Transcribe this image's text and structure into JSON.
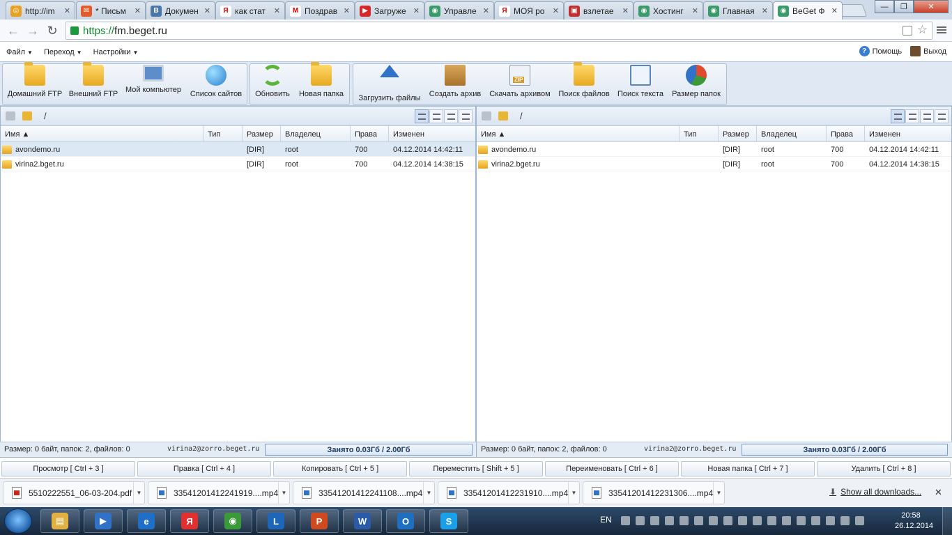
{
  "browser": {
    "tabs": [
      {
        "title": "http://im",
        "color": "#e8a020",
        "glyph": "◎"
      },
      {
        "title": "* Письм",
        "color": "#e45a2a",
        "glyph": "✉"
      },
      {
        "title": "Докумен",
        "color": "#4a76a8",
        "glyph": "B"
      },
      {
        "title": "как стат",
        "color": "#ffffff",
        "glyph": "Я"
      },
      {
        "title": "Поздрав",
        "color": "#ffffff",
        "glyph": "M"
      },
      {
        "title": "Загруже",
        "color": "#d62828",
        "glyph": "▶"
      },
      {
        "title": "Управле",
        "color": "#3a9a6a",
        "glyph": "◉"
      },
      {
        "title": "МОЯ ро",
        "color": "#ffffff",
        "glyph": "Я"
      },
      {
        "title": "взлетае",
        "color": "#c03030",
        "glyph": "▣"
      },
      {
        "title": "Хостинг",
        "color": "#3a9a6a",
        "glyph": "◉"
      },
      {
        "title": "Главная",
        "color": "#3a9a6a",
        "glyph": "◉"
      },
      {
        "title": "BeGet Ф",
        "color": "#3a9a6a",
        "glyph": "◉"
      }
    ],
    "window_controls": [
      "—",
      "❐",
      "✕"
    ],
    "url_scheme": "https://",
    "url_host": "fm.beget.ru"
  },
  "menubar": {
    "items": [
      "Файл",
      "Переход",
      "Настройки"
    ],
    "help_label": "Помощь",
    "exit_label": "Выход"
  },
  "toolbar": {
    "buttons": [
      {
        "label": "Домашний FTP",
        "icon": "home-ftp-icon"
      },
      {
        "label": "Внешний FTP",
        "icon": "external-ftp-icon"
      },
      {
        "label": "Мой компьютер",
        "icon": "my-computer-icon"
      },
      {
        "label": "Список сайтов",
        "icon": "site-list-icon"
      },
      {
        "label": "Обновить",
        "icon": "refresh-icon"
      },
      {
        "label": "Новая папка",
        "icon": "new-folder-icon"
      },
      {
        "label": "Загрузить файлы",
        "icon": "upload-icon"
      },
      {
        "label": "Создать архив",
        "icon": "create-archive-icon"
      },
      {
        "label": "Скачать архивом",
        "icon": "download-zip-icon"
      },
      {
        "label": "Поиск файлов",
        "icon": "search-files-icon"
      },
      {
        "label": "Поиск текста",
        "icon": "search-text-icon"
      },
      {
        "label": "Размер папок",
        "icon": "folder-size-icon"
      }
    ]
  },
  "panels": {
    "path": "/",
    "columns": [
      "Имя ▲",
      "Тип",
      "Размер",
      "Владелец",
      "Права",
      "Изменен"
    ],
    "rows": [
      {
        "name": "avondemo.ru",
        "type": "",
        "size": "[DIR]",
        "owner": "root",
        "perms": "700",
        "modified": "04.12.2014 14:42:11"
      },
      {
        "name": "virina2.bget.ru",
        "type": "",
        "size": "[DIR]",
        "owner": "root",
        "perms": "700",
        "modified": "04.12.2014 14:38:15"
      }
    ],
    "status_size": "Размер: 0 байт, папок: 2, файлов: 0",
    "status_user": "virina2@zorro.beget.ru",
    "status_quota": "Занято 0.03Гб / 2.00Гб"
  },
  "fkeys": [
    "Просмотр [ Ctrl + 3 ]",
    "Правка [ Ctrl + 4 ]",
    "Копировать [ Ctrl + 5 ]",
    "Переместить [ Shift + 5 ]",
    "Переименовать [ Ctrl + 6 ]",
    "Новая папка [ Ctrl + 7 ]",
    "Удалить [ Ctrl + 8 ]"
  ],
  "downloads": {
    "items": [
      {
        "name": "5510222551_06-03-204.pdf",
        "kind": "pdf"
      },
      {
        "name": "33541201412241919....mp4",
        "kind": "mp4"
      },
      {
        "name": "33541201412241108....mp4",
        "kind": "mp4"
      },
      {
        "name": "33541201412231910....mp4",
        "kind": "mp4"
      },
      {
        "name": "33541201412231306....mp4",
        "kind": "mp4"
      }
    ],
    "show_all": "Show all downloads...",
    "close": "✕"
  },
  "taskbar": {
    "apps": [
      {
        "name": "explorer",
        "color": "#e0b040",
        "glyph": "▤"
      },
      {
        "name": "media",
        "color": "#2f72c8",
        "glyph": "▶"
      },
      {
        "name": "ie",
        "color": "#1f6fc8",
        "glyph": "e"
      },
      {
        "name": "yandex",
        "color": "#e03030",
        "glyph": "Я"
      },
      {
        "name": "chrome",
        "color": "#3a9a3a",
        "glyph": "◉"
      },
      {
        "name": "lync",
        "color": "#1e66b8",
        "glyph": "L"
      },
      {
        "name": "powerpoint",
        "color": "#d04a20",
        "glyph": "P"
      },
      {
        "name": "word",
        "color": "#2a5aa8",
        "glyph": "W"
      },
      {
        "name": "outlook",
        "color": "#1e6fc0",
        "glyph": "O"
      },
      {
        "name": "skype",
        "color": "#1aa0e8",
        "glyph": "S"
      }
    ],
    "lang": "EN",
    "time": "20:58",
    "date": "26.12.2014"
  }
}
